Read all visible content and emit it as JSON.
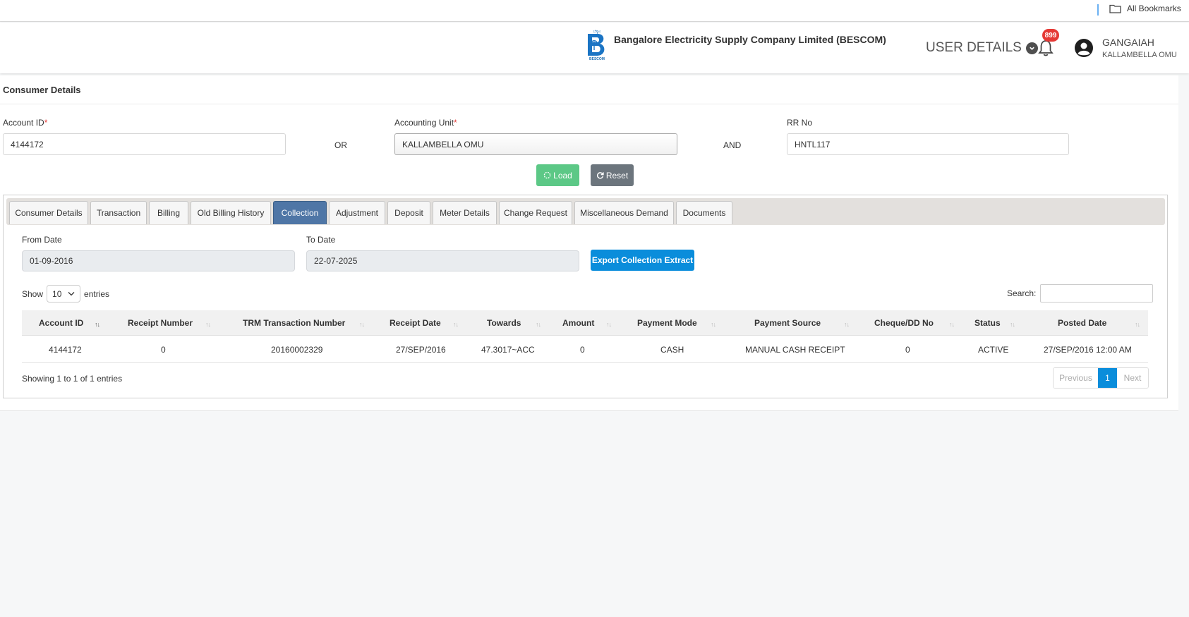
{
  "bookmarks": {
    "all_bookmarks": "All Bookmarks"
  },
  "header": {
    "company": "Bangalore Electricity Supply Company Limited (BESCOM)",
    "logo_text": "BESCOM",
    "user_details_menu": "USER DETAILS",
    "notification_count": "899",
    "user_name": "GANGAIAH",
    "user_unit": "KALLAMBELLA OMU"
  },
  "consumer": {
    "title": "Consumer Details",
    "account_id_label": "Account ID",
    "account_id_value": "4144172",
    "or_label": "OR",
    "unit_label": "Accounting Unit",
    "unit_value": "KALLAMBELLA OMU",
    "and_label": "AND",
    "rr_label": "RR No",
    "rr_value": "HNTL117",
    "required_mark": "*",
    "load_button": "Load",
    "reset_button": "Reset"
  },
  "tabs": [
    "Consumer Details",
    "Transaction",
    "Billing",
    "Old Billing History",
    "Collection",
    "Adjustment",
    "Deposit",
    "Meter Details",
    "Change Request",
    "Miscellaneous Demand",
    "Documents"
  ],
  "active_tab": "Collection",
  "collection": {
    "from_label": "From Date",
    "from_value": "01-09-2016",
    "to_label": "To Date",
    "to_value": "22-07-2025",
    "export_button": "Export Collection Extract",
    "show_label": "Show",
    "entries_count": "10",
    "entries_label": "entries",
    "search_label": "Search:",
    "columns": [
      "Account ID",
      "Receipt Number",
      "TRM Transaction Number",
      "Receipt Date",
      "Towards",
      "Amount",
      "Payment Mode",
      "Payment Source",
      "Cheque/DD No",
      "Status",
      "Posted Date"
    ],
    "rows": [
      [
        "4144172",
        "0",
        "20160002329",
        "27/SEP/2016",
        "47.3017~ACC",
        "0",
        "CASH",
        "MANUAL CASH RECEIPT",
        "0",
        "ACTIVE",
        "27/SEP/2016 12:00 AM"
      ]
    ],
    "info": "Showing 1 to 1 of 1 entries",
    "pagination": {
      "previous": "Previous",
      "current": "1",
      "next": "Next"
    }
  },
  "colors": {
    "active_tab": "#4f76a6",
    "primary": "#0a8ddb",
    "load": "#5cc886",
    "reset": "#6c757d",
    "badge": "#e53935"
  }
}
